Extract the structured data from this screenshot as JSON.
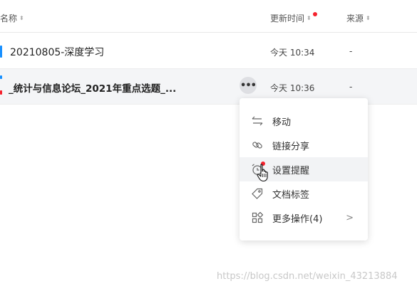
{
  "header": {
    "name_label": "名称",
    "updated_label": "更新时间",
    "source_label": "来源",
    "sort_glyph": "⬍"
  },
  "files": [
    {
      "name": "20210805-深度学习",
      "updated": "今天 10:34",
      "source": "-"
    },
    {
      "name": "_统计与信息论坛_2021年重点选题_...",
      "updated": "今天 10:36",
      "source": "-"
    }
  ],
  "row_actions": {
    "more_glyph": "•••"
  },
  "context_menu": {
    "items": [
      {
        "label": "移动",
        "icon": "move-icon"
      },
      {
        "label": "链接分享",
        "icon": "link-icon"
      },
      {
        "label": "设置提醒",
        "icon": "alarm-clock-icon"
      },
      {
        "label": "文档标签",
        "icon": "tag-icon"
      },
      {
        "label": "更多操作(4)",
        "icon": "grid-icon",
        "chevron": ">"
      }
    ]
  },
  "watermark": "https://blog.csdn.net/weixin_43213884",
  "colors": {
    "accent_blue": "#1890ff",
    "badge_red": "#f5222d",
    "selected_row_bg": "#f4f5f7",
    "hover_item_bg": "#f2f3f5"
  }
}
